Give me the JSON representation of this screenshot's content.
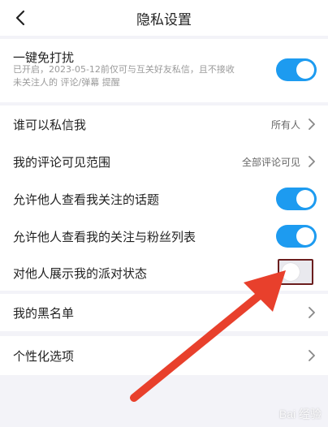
{
  "header": {
    "title": "隐私设置",
    "back_icon": "chevron-left-icon"
  },
  "dnd": {
    "label": "一键免打扰",
    "desc_line1": "已开启，2023-05-12前仅可与互关好友私信，且不接收",
    "desc_line2": "未关注人的 评论/弹幕 提醒",
    "enabled": true
  },
  "settings": {
    "who_can_message": {
      "label": "谁可以私信我",
      "value": "所有人"
    },
    "comment_visibility": {
      "label": "我的评论可见范围",
      "value": "全部评论可见"
    },
    "allow_view_topics": {
      "label": "允许他人查看我关注的话题",
      "enabled": true
    },
    "allow_view_follow_lists": {
      "label": "允许他人查看我的关注与粉丝列表",
      "enabled": true
    },
    "show_party_status": {
      "label": "对他人展示我的派对状态",
      "enabled": false
    }
  },
  "blacklist": {
    "label": "我的黑名单"
  },
  "personalization": {
    "label": "个性化选项"
  },
  "watermark": "Bai 经验",
  "colors": {
    "accent": "#1d9bf0",
    "annotation_arrow": "#e8402c",
    "highlight_box": "#6b1e1e"
  }
}
